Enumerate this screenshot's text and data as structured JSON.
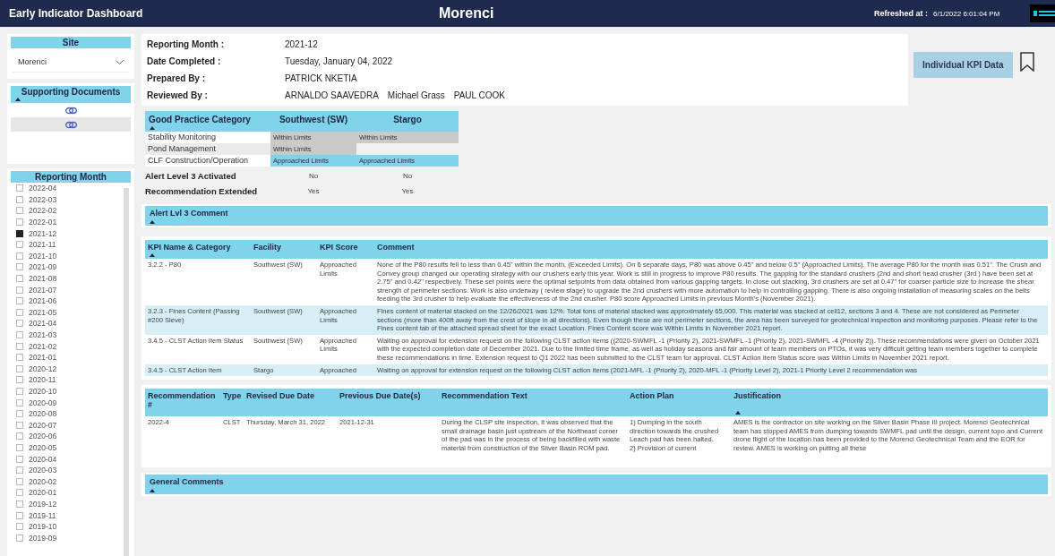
{
  "header": {
    "app_title": "Early Indicator Dashboard",
    "site_title": "Morenci",
    "refreshed_label": "Refreshed at :",
    "refreshed_value": "6/1/2022 6:01:04 PM"
  },
  "sidebar": {
    "site": {
      "title": "Site",
      "value": "Morenci"
    },
    "documents": {
      "title": "Supporting Documents",
      "sorted": true,
      "items": [
        {
          "selected": false
        },
        {
          "selected": true
        }
      ]
    },
    "months": {
      "title": "Reporting Month",
      "items": [
        {
          "label": "2022-04",
          "checked": false
        },
        {
          "label": "2022-03",
          "checked": false
        },
        {
          "label": "2022-02",
          "checked": false
        },
        {
          "label": "2022-01",
          "checked": false
        },
        {
          "label": "2021-12",
          "checked": true
        },
        {
          "label": "2021-11",
          "checked": false
        },
        {
          "label": "2021-10",
          "checked": false
        },
        {
          "label": "2021-09",
          "checked": false
        },
        {
          "label": "2021-08",
          "checked": false
        },
        {
          "label": "2021-07",
          "checked": false
        },
        {
          "label": "2021-06",
          "checked": false
        },
        {
          "label": "2021-05",
          "checked": false
        },
        {
          "label": "2021-04",
          "checked": false
        },
        {
          "label": "2021-03",
          "checked": false
        },
        {
          "label": "2021-02",
          "checked": false
        },
        {
          "label": "2021-01",
          "checked": false
        },
        {
          "label": "2020-12",
          "checked": false
        },
        {
          "label": "2020-11",
          "checked": false
        },
        {
          "label": "2020-10",
          "checked": false
        },
        {
          "label": "2020-09",
          "checked": false
        },
        {
          "label": "2020-08",
          "checked": false
        },
        {
          "label": "2020-07",
          "checked": false
        },
        {
          "label": "2020-06",
          "checked": false
        },
        {
          "label": "2020-05",
          "checked": false
        },
        {
          "label": "2020-04",
          "checked": false
        },
        {
          "label": "2020-03",
          "checked": false
        },
        {
          "label": "2020-02",
          "checked": false
        },
        {
          "label": "2020-01",
          "checked": false
        },
        {
          "label": "2019-12",
          "checked": false
        },
        {
          "label": "2019-11",
          "checked": false
        },
        {
          "label": "2019-10",
          "checked": false
        },
        {
          "label": "2019-09",
          "checked": false
        }
      ]
    }
  },
  "report_info": [
    {
      "label": "Reporting Month :",
      "values": [
        "2021-12"
      ]
    },
    {
      "label": "Date Completed :",
      "values": [
        "Tuesday, January 04, 2022"
      ]
    },
    {
      "label": "Prepared By :",
      "values": [
        "PATRICK NKETIA"
      ]
    },
    {
      "label": "Reviewed By :",
      "values": [
        "ARNALDO SAAVEDRA",
        "Michael Grass",
        "PAUL COOK"
      ]
    }
  ],
  "kpi_button": "Individual KPI Data",
  "good_practice": {
    "columns": [
      {
        "label": "Good Practice Category",
        "sorted": true
      },
      {
        "label": "Southwest (SW)",
        "sorted": false
      },
      {
        "label": "Stargo",
        "sorted": false
      }
    ],
    "rows": [
      {
        "cells": [
          {
            "text": "Stability Monitoring",
            "color": "#ffffff"
          },
          {
            "text": "Within Limits",
            "color": "#c9c9c9"
          },
          {
            "text": "Within Limits",
            "color": "#c9c9c9"
          }
        ]
      },
      {
        "cells": [
          {
            "text": "Pond Management",
            "color": "#eaeaea"
          },
          {
            "text": "Within Limits",
            "color": "#c9c9c9"
          },
          {}
        ]
      },
      {
        "cells": [
          {
            "text": "CLF Construction/Operation",
            "color": "#ffffff"
          },
          {
            "text": "Approached Limits",
            "color": "#7fd3ea"
          },
          {
            "text": "Approached Limits",
            "color": "#7fd3ea"
          }
        ]
      }
    ]
  },
  "alerts": [
    {
      "label": "Alert Level 3 Activated",
      "values": [
        "No",
        "No"
      ]
    },
    {
      "label": "Recommendation Extended",
      "values": [
        "Yes",
        "Yes"
      ]
    }
  ],
  "alert_comment": {
    "title": "Alert Lvl 3 Comment",
    "sorted": true
  },
  "kpi_table": {
    "columns": [
      {
        "label": "KPI Name & Category",
        "sorted": true
      },
      {
        "label": "Facility",
        "sorted": false
      },
      {
        "label": "KPI Score",
        "sorted": false
      },
      {
        "label": "Comment",
        "sorted": false
      }
    ],
    "rows": [
      {
        "selected": false,
        "cells": [
          "3.2.2 - P80",
          "Southwest (SW)",
          "Approached Limits",
          "None of the P80 results fell to less than 0.45\" within the month, (Exceeded Limits). On 6 separate days, P80 was above 0.45\" and below 0.5\" (Approached Limits). The average P80 for the month was 0.51\". The Crush and Convey group changed our operating strategy with our crushers early this year. Work is still in progress to improve P80 results. The gapping for the standard crushers (2nd and short head crusher (3rd ) have been set at 2.75\" and 0.42\" respectively. These set points were the optimal setpoints from data obtained from various gapping targets. In close out stacking, 3rd crushers are set at 0.47\" for coarser particle size to increase the shear strength of perimeter sections. Work is also underway ( review stage) to upgrade the 2nd crushers with more automation to help in controlling gapping. There is also ongoing installation of measuring scales on the belts feeding the 3rd crusher to help evaluate the effectiveness of the 2nd crusher. P80 score Approached Limits in previous Month's (November 2021)."
        ]
      },
      {
        "selected": true,
        "cells": [
          "3.2.3 - Fines Content (Passing #200 Sieve)",
          "Southwest (SW)",
          "Approached Limits",
          "Fines content of material stacked on the 12/26/2021 was 12%. Total tons of material stacked was approximately 65,000. This material was stacked at cell12, sections 3 and 4. These are not considered as Perimeter sections (more than 400ft away from the crest of slope in all directions). Even though these are not perimeter sections, the area has been surveyed for geotechnical inspection and monitoring purposes. Please refer to the Fines content tab of the attached spread sheet for the exact Location. Fines Content score was Within Limits in November 2021 report."
        ]
      },
      {
        "selected": false,
        "cells": [
          "3.4.5 - CLST Action Item Status",
          "Southwest (SW)",
          "Approached Limits",
          "Waiting on approval for extension request on the following CLST action items ((2020-SWMFL -1 (Priority 2), 2021-SWMFL -1 (Priority 2), 2021-SWMFL -4 (Priority 2)). These recommendations were given on October 2021 with the expected completion date of December 2021. Due to the limited time frame, as well as holiday seasons and fair amount of team members on PTOs, it was very difficult getting team members together to complete these recommendations in time. Extension request to Q1 2022 has been submitted to the CLST team for approval. CLST Action Item Status score was Within Limits in November 2021 report."
        ]
      },
      {
        "selected": true,
        "cells": [
          "3.4.5 - CLST Action Item",
          "Stargo",
          "Approached",
          "Waiting on approval for extension request on the following CLST action items (2021-MFL -1 (Priority 2), 2020-MFL -1 (Priority Level 2), 2021-1 Priority Level 2 recommendation was"
        ]
      }
    ]
  },
  "recommendations": {
    "columns": [
      {
        "label": "Recommendation #",
        "sorted": false
      },
      {
        "label": "Type",
        "sorted": false
      },
      {
        "label": "Revised Due Date",
        "sorted": false
      },
      {
        "label": "Previous Due Date(s)",
        "sorted": false
      },
      {
        "label": "Recommendation Text",
        "sorted": false
      },
      {
        "label": "Action Plan",
        "sorted": false
      },
      {
        "label": "Justification",
        "sorted": true
      }
    ],
    "rows": [
      {
        "cells": [
          "2022-4",
          "CLST",
          "Thursday, March 31, 2022",
          "2021-12-31",
          "During the CLSP site inspection, it was observed that the small drainage basin just upstream of the Northeast corner of the pad was in the process of being backfilled with waste material from construction of the Silver Basin ROM pad.",
          "1) Dumping in the south direction towards the crushed Leach pad has been halted.\n2) Provision of current",
          "AMES is the contractor on site working on the Silver Basin Phase III project. Morenci Geotechnical team has stopped AMES from dumping towards SWMFL pad until the design, current topo and Current drone flight of the location has been provided to the Morenci Geotechnical Team and the EOR for review. AMES is working on putting all these"
        ]
      }
    ]
  },
  "general_comments": {
    "title": "General Comments",
    "sorted": true
  }
}
